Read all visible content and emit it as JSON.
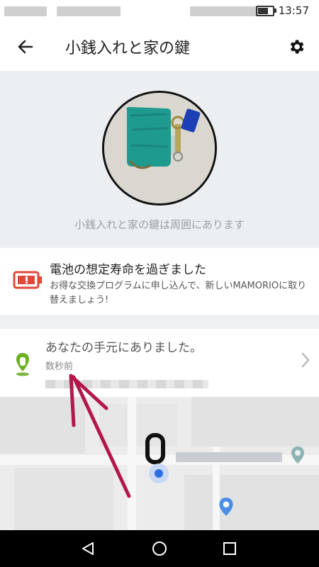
{
  "status_bar": {
    "time": "13:57"
  },
  "header": {
    "title": "小銭入れと家の鍵"
  },
  "hero": {
    "caption": "小銭入れと家の鍵は周囲にあります"
  },
  "alert": {
    "title": "電池の想定寿命を過ぎました",
    "body": "お得な交換プログラムに申し込んで、新しいMAMORIOに取り替えましょう!"
  },
  "location": {
    "title": "あなたの手元にありました。",
    "time": "数秒前"
  },
  "icons": {
    "back": "arrow-left-icon",
    "settings": "gear-icon",
    "battery_alert": "battery-warning-icon",
    "pin": "map-pin-icon",
    "chevron": "chevron-right-icon"
  },
  "colors": {
    "alert_red": "#e2473a",
    "pin_green": "#6bb120",
    "arrow": "#b3174d"
  }
}
